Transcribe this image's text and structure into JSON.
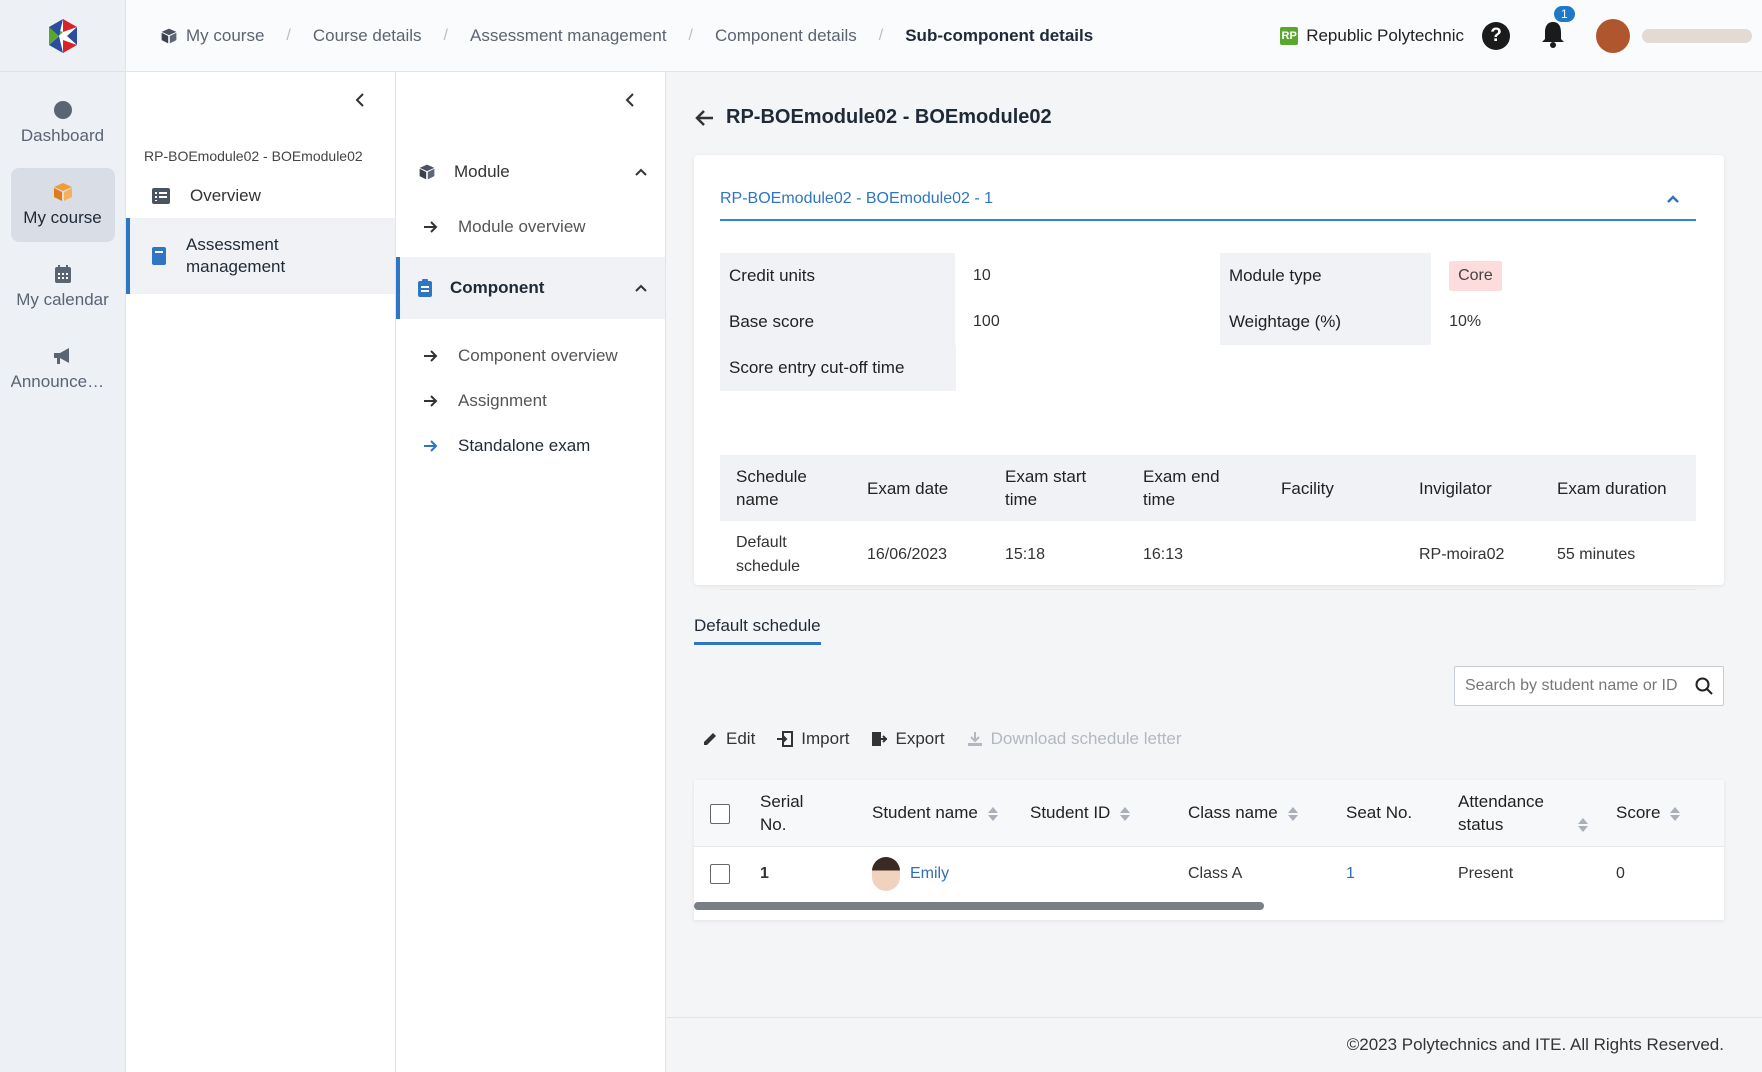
{
  "rail": {
    "items": [
      {
        "label": "Dashboard"
      },
      {
        "label": "My course"
      },
      {
        "label": "My calendar"
      },
      {
        "label": "Announcem..."
      }
    ]
  },
  "breadcrumb": [
    "My course",
    "Course details",
    "Assessment management",
    "Component details",
    "Sub-component details"
  ],
  "header": {
    "institution": "Republic Polytechnic",
    "institution_badge": "RP",
    "help": "?",
    "notifications": "1"
  },
  "panel2": {
    "title": "RP-BOEmodule02 - BOEmodule02",
    "items": [
      {
        "label": "Overview"
      },
      {
        "label": "Assessment management"
      }
    ]
  },
  "panel3": {
    "module_group": "Module",
    "module_items": [
      "Module overview"
    ],
    "component_group": "Component",
    "component_items": [
      "Component overview",
      "Assignment",
      "Standalone exam"
    ]
  },
  "page": {
    "title": "RP-BOEmodule02 - BOEmodule02"
  },
  "card": {
    "header": "RP-BOEmodule02 - BOEmodule02 - 1",
    "credit_units_label": "Credit units",
    "credit_units": "10",
    "module_type_label": "Module type",
    "module_type": "Core",
    "base_score_label": "Base score",
    "base_score": "100",
    "weightage_label": "Weightage (%)",
    "weightage": "10%",
    "cutoff_label": "Score entry cut-off time",
    "schedule_headers": [
      "Schedule name",
      "Exam date",
      "Exam start time",
      "Exam end time",
      "Facility",
      "Invigilator",
      "Exam duration"
    ],
    "schedule_rows": [
      [
        "Default schedule",
        "16/06/2023",
        "15:18",
        "16:13",
        "",
        "RP-moira02",
        "55 minutes"
      ]
    ]
  },
  "tab": "Default schedule",
  "search": {
    "placeholder": "Search by student name or ID"
  },
  "toolbar": {
    "edit": "Edit",
    "import": "Import",
    "export": "Export",
    "download": "Download schedule letter"
  },
  "grid": {
    "headers": [
      "Serial No.",
      "Student name",
      "Student ID",
      "Class name",
      "Seat No.",
      "Attendance status",
      "Score"
    ],
    "rows": [
      {
        "serial": "1",
        "name": "Emily",
        "id": "",
        "class": "Class A",
        "seat": "1",
        "attendance": "Present",
        "score": "0"
      }
    ]
  },
  "footer": "©2023 Polytechnics and ITE. All Rights Reserved.",
  "colors": {
    "accent": "#2e76c3",
    "core_tag": "#fcdcdc",
    "brand_green": "#5aa72f"
  }
}
